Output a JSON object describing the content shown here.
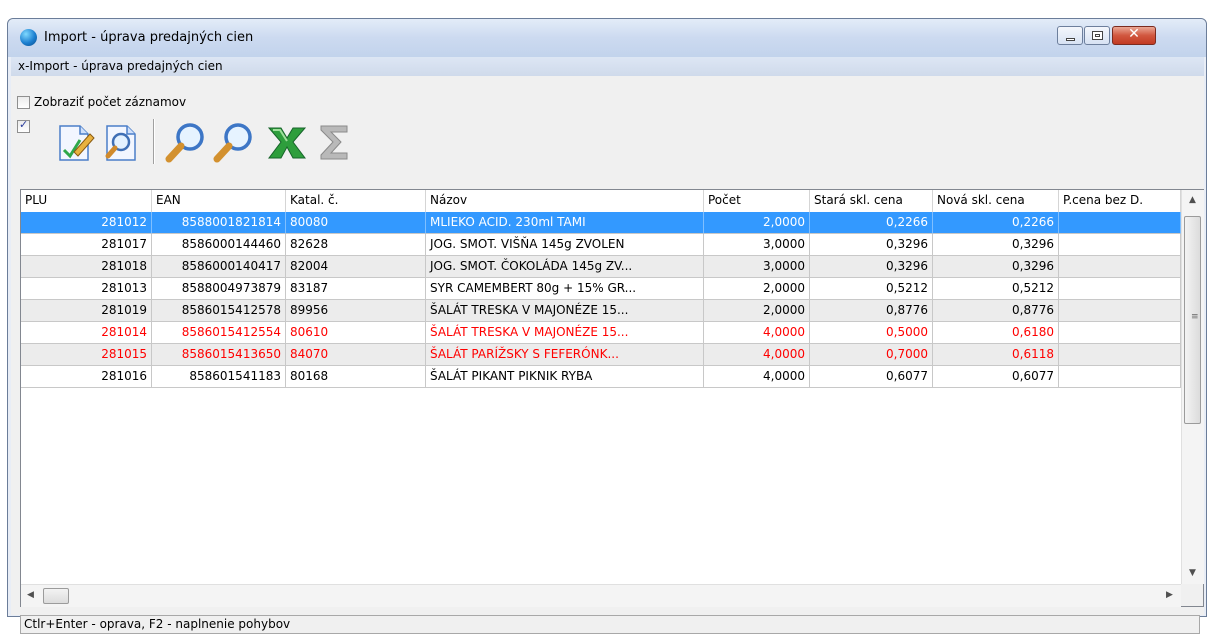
{
  "window": {
    "title": "Import - úprava predajných cien"
  },
  "subheader": {
    "text": "x-Import - úprava predajných cien"
  },
  "options": {
    "show_count_label": "Zobraziť počet záznamov",
    "show_count_checked": false,
    "select_all_checked": true
  },
  "toolbar": {
    "icons": [
      "edit-document-icon",
      "preview-document-icon",
      "search-icon",
      "search-next-icon",
      "excel-export-icon",
      "sum-icon"
    ]
  },
  "grid": {
    "columns": [
      "PLU",
      "EAN",
      "Katal. č.",
      "Názov",
      "Počet",
      "Stará skl. cena",
      "Nová skl. cena",
      "P.cena bez D."
    ],
    "rows": [
      [
        "281012",
        "8588001821814",
        "80080",
        "MLIEKO ACID. 230ml TAMI",
        "2,0000",
        "0,2266",
        "0,2266",
        ""
      ],
      [
        "281017",
        "8586000144460",
        "82628",
        "JOG. SMOT. VIŠŇA 145g ZVOLEN",
        "3,0000",
        "0,3296",
        "0,3296",
        ""
      ],
      [
        "281018",
        "8586000140417",
        "82004",
        "JOG. SMOT. ČOKOLÁDA 145g ZV...",
        "3,0000",
        "0,3296",
        "0,3296",
        ""
      ],
      [
        "281013",
        "8588004973879",
        "83187",
        "SYR CAMEMBERT 80g + 15% GR...",
        "2,0000",
        "0,5212",
        "0,5212",
        ""
      ],
      [
        "281019",
        "8586015412578",
        "89956",
        "ŠALÁT TRESKA V MAJONÉZE 15...",
        "2,0000",
        "0,8776",
        "0,8776",
        ""
      ],
      [
        "281014",
        "8586015412554",
        "80610",
        "ŠALÁT TRESKA V MAJONÉZE 15...",
        "4,0000",
        "0,5000",
        "0,6180",
        ""
      ],
      [
        "281015",
        "8586015413650",
        "84070",
        "ŠALÁT PARÍŽSKY S FEFERÓNK...",
        "4,0000",
        "0,7000",
        "0,6118",
        ""
      ],
      [
        "281016",
        "858601541183",
        "80168",
        "ŠALÁT PIKANT PIKNIK RYBA",
        "4,0000",
        "0,6077",
        "0,6077",
        ""
      ]
    ],
    "row_states": [
      "selected",
      "normal",
      "alt",
      "normal",
      "alt",
      "red",
      "red-alt",
      "normal"
    ]
  },
  "status": {
    "text": "Ctlr+Enter - oprava, F2 - naplnenie pohybov"
  },
  "colors": {
    "selection": "#3399ff",
    "changed_price": "#ff0000",
    "close_button": "#c8432a"
  }
}
